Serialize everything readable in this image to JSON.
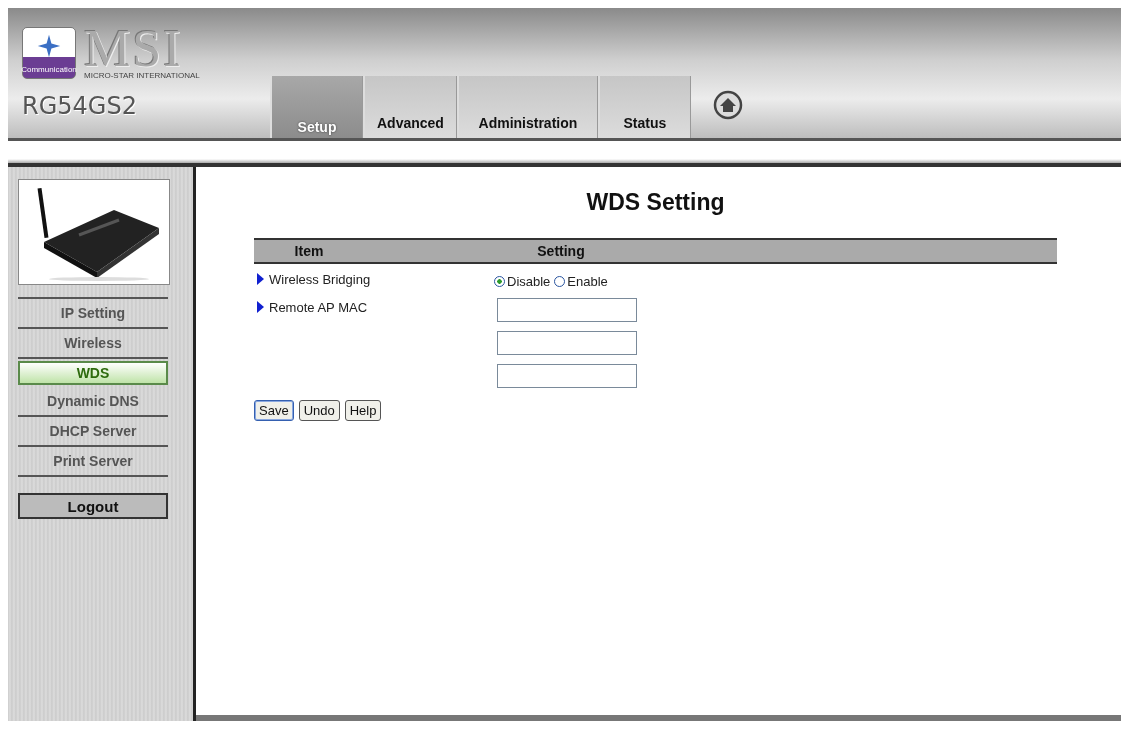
{
  "header": {
    "logo_text": "MSI",
    "logo_subtitle": "MICRO-STAR INTERNATIONAL",
    "logo_badge": "Communication",
    "model": "RG54GS2"
  },
  "tabs": [
    {
      "label": "Setup",
      "selected": true
    },
    {
      "label": "Advanced",
      "selected": false
    },
    {
      "label": "Administration",
      "selected": false
    },
    {
      "label": "Status",
      "selected": false
    }
  ],
  "sidebar": {
    "items": [
      {
        "label": "IP Setting",
        "selected": false
      },
      {
        "label": "Wireless",
        "selected": false
      },
      {
        "label": "WDS",
        "selected": true
      },
      {
        "label": "Dynamic DNS",
        "selected": false
      },
      {
        "label": "DHCP Server",
        "selected": false
      },
      {
        "label": "Print Server",
        "selected": false
      }
    ],
    "logout": "Logout"
  },
  "page_title": "WDS Setting",
  "table": {
    "columns": [
      "Item",
      "Setting"
    ],
    "rows": [
      {
        "kind": "radio",
        "label": "Wireless Bridging",
        "options": [
          {
            "label": "Disable",
            "selected": true
          },
          {
            "label": "Enable",
            "selected": false
          }
        ]
      },
      {
        "kind": "inputs",
        "label": "Remote AP MAC",
        "fields": [
          {
            "kind": "text"
          },
          {
            "kind": "text"
          },
          {
            "kind": "text"
          }
        ]
      }
    ]
  },
  "buttons": [
    {
      "label": "Save",
      "focused": true
    },
    {
      "label": "Undo",
      "focused": false
    },
    {
      "label": "Help",
      "focused": false
    }
  ]
}
